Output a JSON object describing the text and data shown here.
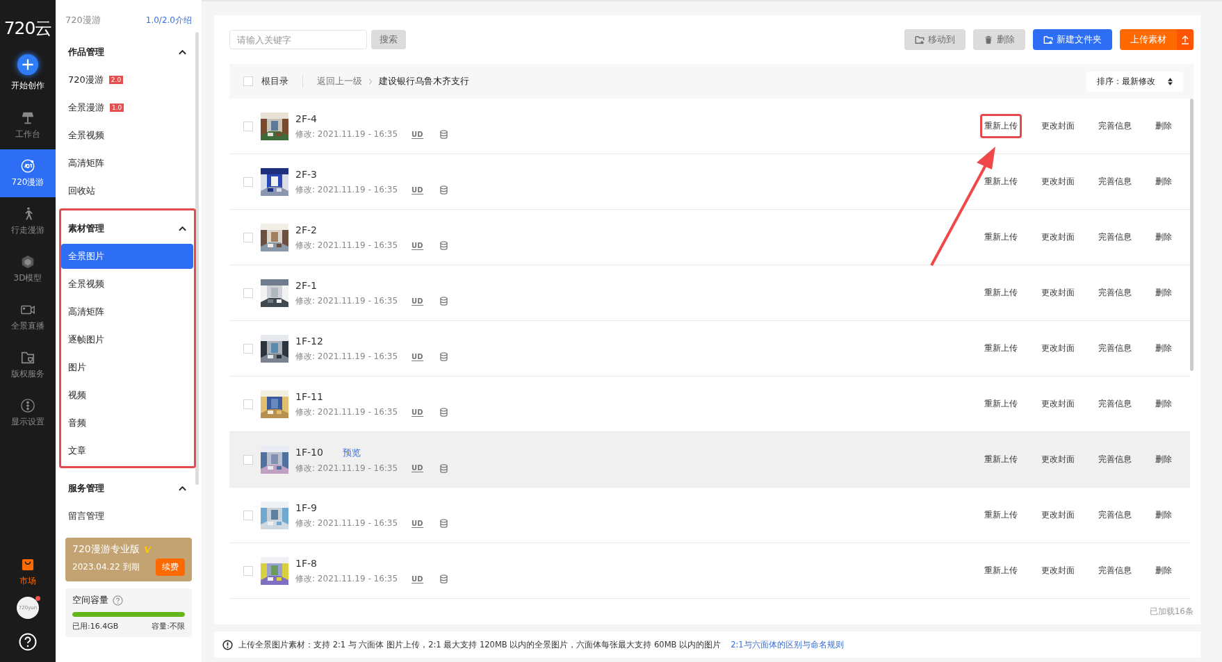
{
  "rail": {
    "logo": "720云",
    "items": [
      {
        "kind": "create",
        "label": "开始创作"
      },
      {
        "kind": "nav",
        "label": "工作台",
        "selected": false
      },
      {
        "kind": "nav",
        "label": "720漫游",
        "selected": true
      },
      {
        "kind": "nav",
        "label": "行走漫游",
        "selected": false
      },
      {
        "kind": "nav",
        "label": "3D模型",
        "selected": false
      },
      {
        "kind": "nav",
        "label": "全景直播",
        "selected": false
      },
      {
        "kind": "nav",
        "label": "版权服务",
        "selected": false
      },
      {
        "kind": "nav",
        "label": "显示设置",
        "selected": false
      }
    ],
    "market": {
      "label": "市场"
    },
    "avatar": {
      "text": "720yun",
      "unread": true
    }
  },
  "sidebar": {
    "title": "720漫游",
    "intro_link": "1.0/2.0介绍",
    "sections": [
      {
        "title": "作品管理",
        "expanded": true,
        "highlighted": false,
        "items": [
          {
            "label": "720漫游",
            "badge": "2.0",
            "selected": false
          },
          {
            "label": "全景漫游",
            "badge": "1.0",
            "selected": false
          },
          {
            "label": "全景视频",
            "selected": false
          },
          {
            "label": "高清矩阵",
            "selected": false
          },
          {
            "label": "回收站",
            "selected": false
          }
        ]
      },
      {
        "title": "素材管理",
        "expanded": true,
        "highlighted": true,
        "items": [
          {
            "label": "全景图片",
            "selected": true
          },
          {
            "label": "全景视频",
            "selected": false
          },
          {
            "label": "高清矩阵",
            "selected": false
          },
          {
            "label": "逐帧图片",
            "selected": false
          },
          {
            "label": "图片",
            "selected": false
          },
          {
            "label": "视频",
            "selected": false
          },
          {
            "label": "音频",
            "selected": false
          },
          {
            "label": "文章",
            "selected": false
          }
        ]
      },
      {
        "title": "服务管理",
        "expanded": true,
        "highlighted": false,
        "items": [
          {
            "label": "留言管理",
            "selected": false
          }
        ]
      }
    ],
    "pro_card": {
      "title": "720漫游专业版",
      "expiry": "2023.04.22 到期",
      "renew": "续费"
    },
    "storage": {
      "title": "空间容量",
      "level": 1,
      "used": "已用:16.4GB",
      "capacity": "容量:不限"
    }
  },
  "search": {
    "placeholder": "请输入关键字",
    "button": "搜索"
  },
  "toolbar": [
    {
      "kind": "move",
      "label": "移动到",
      "disabled": true
    },
    {
      "kind": "delete",
      "label": "删除",
      "disabled": true
    },
    {
      "kind": "folder",
      "label": "新建文件夹",
      "disabled": false
    },
    {
      "kind": "upload",
      "label": "上传素材",
      "disabled": false
    }
  ],
  "breadcrumb": {
    "checked": false,
    "root": "根目录",
    "back": "返回上一级",
    "current": "建设银行乌鲁木齐支行"
  },
  "sort": {
    "label": "排序：最新修改"
  },
  "rows": [
    {
      "name": "2F-4",
      "modified": "修改: 2021.11.19 - 16:35",
      "tag": "UD",
      "checked": false,
      "hovered": false,
      "highlighted": true
    },
    {
      "name": "2F-3",
      "modified": "修改: 2021.11.19 - 16:35",
      "tag": "UD",
      "checked": false,
      "hovered": false,
      "highlighted": false
    },
    {
      "name": "2F-2",
      "modified": "修改: 2021.11.19 - 16:35",
      "tag": "UD",
      "checked": false,
      "hovered": false,
      "highlighted": false
    },
    {
      "name": "2F-1",
      "modified": "修改: 2021.11.19 - 16:35",
      "tag": "UD",
      "checked": false,
      "hovered": false,
      "highlighted": false
    },
    {
      "name": "1F-12",
      "modified": "修改: 2021.11.19 - 16:35",
      "tag": "UD",
      "checked": false,
      "hovered": false,
      "highlighted": false
    },
    {
      "name": "1F-11",
      "modified": "修改: 2021.11.19 - 16:35",
      "tag": "UD",
      "checked": false,
      "hovered": false,
      "highlighted": false
    },
    {
      "name": "1F-10",
      "preview": "预览",
      "modified": "修改: 2021.11.19 - 16:35",
      "tag": "UD",
      "checked": false,
      "hovered": true,
      "highlighted": false
    },
    {
      "name": "1F-9",
      "modified": "修改: 2021.11.19 - 16:35",
      "tag": "UD",
      "checked": false,
      "hovered": false,
      "highlighted": false
    },
    {
      "name": "1F-8",
      "modified": "修改: 2021.11.19 - 16:35",
      "tag": "UD",
      "checked": false,
      "hovered": false,
      "highlighted": false
    }
  ],
  "row_actions": [
    [
      "重新上传",
      "更改封面",
      "完善信息",
      "删除"
    ],
    [
      "重新上传",
      "更改封面",
      "完善信息",
      "删除"
    ],
    [
      "重新上传",
      "更改封面",
      "完善信息",
      "删除"
    ],
    [
      "重新上传",
      "更改封面",
      "完善信息",
      "删除"
    ],
    [
      "重新上传",
      "更改封面",
      "完善信息",
      "删除"
    ],
    [
      "重新上传",
      "更改封面",
      "完善信息",
      "删除"
    ],
    [
      "重新上传",
      "更改封面",
      "完善信息",
      "删除"
    ],
    [
      "重新上传",
      "更改封面",
      "完善信息",
      "删除"
    ],
    [
      "重新上传",
      "更改封面",
      "完善信息",
      "删除"
    ]
  ],
  "loaded": "已加载16条",
  "notice": {
    "text": "上传全景图片素材：支持 2:1 与 六面体 图片上传，2:1 最大支持 120MB 以内的全景图片，六面体每张最大支持 60MB 以内的图片",
    "link": "2:1与六面体的区别与命名规则"
  }
}
